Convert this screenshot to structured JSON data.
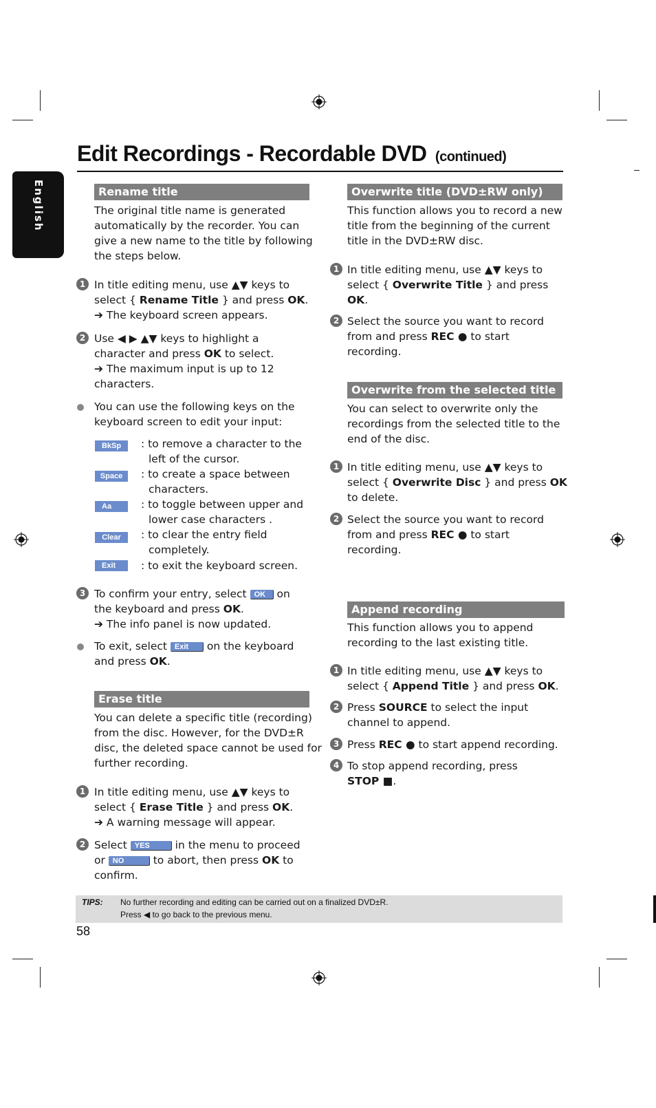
{
  "page": {
    "title": "Edit Recordings - Recordable DVD",
    "title_suffix": "(continued)",
    "language_tab": "English",
    "page_number": "58"
  },
  "left_column": {
    "rename": {
      "header": "Rename title",
      "intro": [
        "The original title name is generated",
        "automatically by the recorder. You can",
        "give a new name to the title by following",
        "the steps below."
      ],
      "step1": {
        "num": "1",
        "line1": "In title editing menu, use ▲▼ keys to",
        "line2_pre": "select { ",
        "line2_bold": "Rename Title",
        "line2_mid": " } and press ",
        "line2_bold2": "OK",
        "line2_post": ".",
        "result": "➔ The keyboard screen appears."
      },
      "step2": {
        "num": "2",
        "line1": "Use ◀ ▶ ▲▼ keys to highlight a",
        "line2_pre": "character and press ",
        "line2_bold": "OK",
        "line2_post": " to select.",
        "result1": "➔ The maximum input is up to 12",
        "result2": "characters."
      },
      "bullet1": [
        "You can use the following keys on the",
        "keyboard screen to edit your input:"
      ],
      "keys": [
        {
          "key": "BkSp",
          "desc1": ": to remove a character to the",
          "desc2": "left of the cursor."
        },
        {
          "key": "Space",
          "desc1": ": to create a space between",
          "desc2": "characters."
        },
        {
          "key": "Aa",
          "desc1": ": to toggle between upper and",
          "desc2": "lower case characters ."
        },
        {
          "key": "Clear",
          "desc1": ": to clear the entry field",
          "desc2": "completely."
        },
        {
          "key": "Exit",
          "desc1": ": to exit the keyboard screen.",
          "desc2": ""
        }
      ],
      "step3": {
        "num": "3",
        "line1_pre": "To confirm your entry, select ",
        "line1_key": "OK",
        "line1_post": " on",
        "line2_pre": "the keyboard and press ",
        "line2_bold": "OK",
        "line2_post": ".",
        "result": "➔ The info panel is now updated."
      },
      "bullet2": {
        "line1_pre": "To exit, select ",
        "line1_key": "Exit",
        "line1_post": " on the keyboard",
        "line2_pre": "and press ",
        "line2_bold": "OK",
        "line2_post": "."
      }
    },
    "erase": {
      "header": "Erase title",
      "intro": [
        "You can delete a specific title (recording)",
        "from the disc. However, for the DVD±R",
        "disc, the deleted space cannot be used for",
        "further recording."
      ],
      "step1": {
        "num": "1",
        "line1": "In title editing menu, use ▲▼ keys to",
        "line2_pre": "select { ",
        "line2_bold": "Erase Title",
        "line2_mid": " } and press ",
        "line2_bold2": "OK",
        "line2_post": ".",
        "result": "➔ A warning message will appear."
      },
      "step2": {
        "num": "2",
        "line1_pre": "Select ",
        "line1_key": "YES",
        "line1_post": " in the menu to proceed",
        "line2_pre": "or ",
        "line2_key": "NO",
        "line2_mid": " to abort, then press ",
        "line2_bold": "OK",
        "line2_post": " to",
        "line3": "confirm."
      }
    }
  },
  "right_column": {
    "overwrite_title": {
      "header": "Overwrite title (DVD±RW only)",
      "intro": [
        "This function allows you to record a new",
        "title from the beginning of the current",
        "title in the DVD±RW disc."
      ],
      "step1": {
        "num": "1",
        "line1": "In title editing menu, use ▲▼ keys to",
        "line2_pre": "select { ",
        "line2_bold": "Overwrite Title",
        "line2_post": " } and press",
        "line3_bold": "OK",
        "line3_post": "."
      },
      "step2": {
        "num": "2",
        "line1": "Select the source you want to record",
        "line2_pre": "from and press ",
        "line2_bold": "REC ●",
        "line2_post": " to start",
        "line3": "recording."
      }
    },
    "overwrite_from": {
      "header": "Overwrite from the selected title",
      "intro": [
        "You can select to overwrite only the",
        "recordings from the selected title to the",
        "end of the disc."
      ],
      "step1": {
        "num": "1",
        "line1": "In title editing menu, use ▲▼ keys to",
        "line2_pre": "select { ",
        "line2_bold": "Overwrite Disc",
        "line2_mid": " } and press ",
        "line2_bold2": "OK",
        "line3": "to delete."
      },
      "step2": {
        "num": "2",
        "line1": "Select the source you want to record",
        "line2_pre": "from and press ",
        "line2_bold": "REC ●",
        "line2_post": " to start",
        "line3": "recording."
      }
    },
    "append": {
      "header": "Append recording",
      "intro": [
        "This function allows you to append",
        "recording to the last existing title."
      ],
      "step1": {
        "num": "1",
        "line1": "In title editing menu, use ▲▼ keys to",
        "line2_pre": "select { ",
        "line2_bold": "Append Title",
        "line2_mid": " } and press ",
        "line2_bold2": "OK",
        "line2_post": "."
      },
      "step2": {
        "num": "2",
        "line1_pre": "Press ",
        "line1_bold": "SOURCE",
        "line1_post": " to select the input",
        "line2": "channel to append."
      },
      "step3": {
        "num": "3",
        "line1_pre": "Press ",
        "line1_bold": "REC ●",
        "line1_post": " to start append recording."
      },
      "step4": {
        "num": "4",
        "line1": "To stop append recording, press",
        "line2_bold": "STOP ■",
        "line2_post": "."
      }
    }
  },
  "tips": {
    "label": "TIPS:",
    "line1": "No further recording and editing can be carried out on a finalized DVD±R.",
    "line2": "Press ◀ to go back to the previous menu."
  },
  "colors": {
    "section_header_bg": "#7f7f7f",
    "key_button_bg": "#6b8ccc",
    "tips_bg": "#dcdcdc",
    "step_number_bg": "#6b6b6b"
  }
}
